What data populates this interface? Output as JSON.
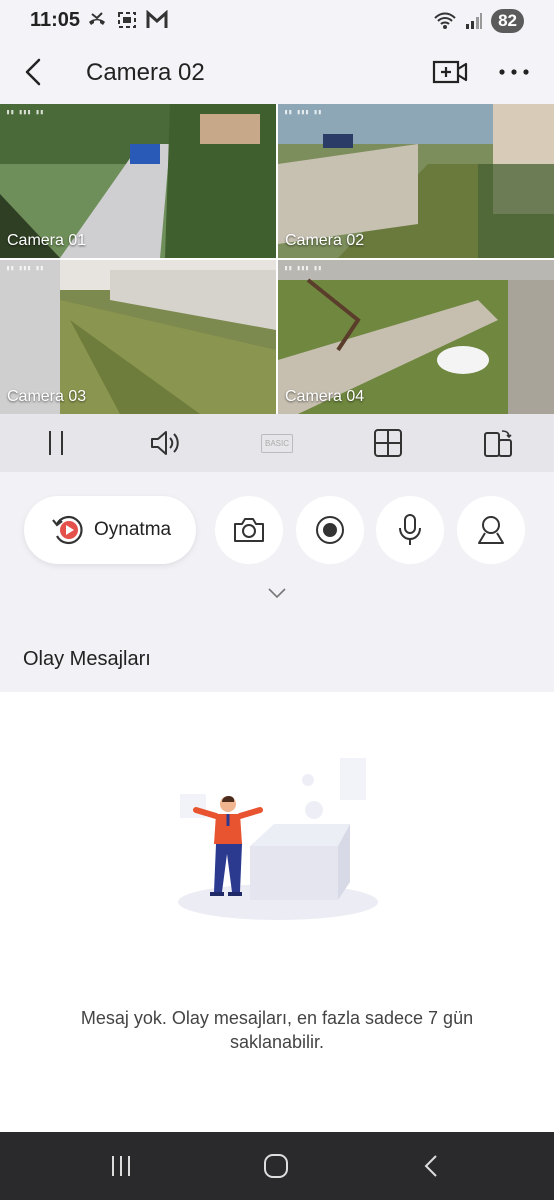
{
  "status_bar": {
    "time": "11:05",
    "battery": "82",
    "icons": [
      "missed-call-icon",
      "screenshot-icon",
      "gmail-icon",
      "wifi-icon",
      "signal-icon"
    ]
  },
  "app_bar": {
    "title": "Camera 02",
    "icons": [
      "back-icon",
      "add-camera-icon",
      "more-icon"
    ]
  },
  "grid": {
    "cameras": [
      {
        "label": "Camera 01",
        "selected": false
      },
      {
        "label": "Camera 02",
        "selected": true
      },
      {
        "label": "Camera 03",
        "selected": false
      },
      {
        "label": "Camera 04",
        "selected": false
      }
    ]
  },
  "control_bar": {
    "items": [
      "pause-icon",
      "speaker-icon",
      "basic-quality",
      "split-view-icon",
      "rotate-screen-icon"
    ],
    "quality_label": "BASIC"
  },
  "actions": {
    "playback_label": "Oynatma",
    "buttons": [
      "camera-icon",
      "record-icon",
      "microphone-icon",
      "ptz-icon"
    ]
  },
  "events": {
    "title": "Olay Mesajları",
    "empty_message": "Mesaj yok. Olay mesajları, en fazla sadece 7 gün saklanabilir."
  },
  "colors": {
    "accent": "#e4514b",
    "selected_border": "#e4514b"
  }
}
